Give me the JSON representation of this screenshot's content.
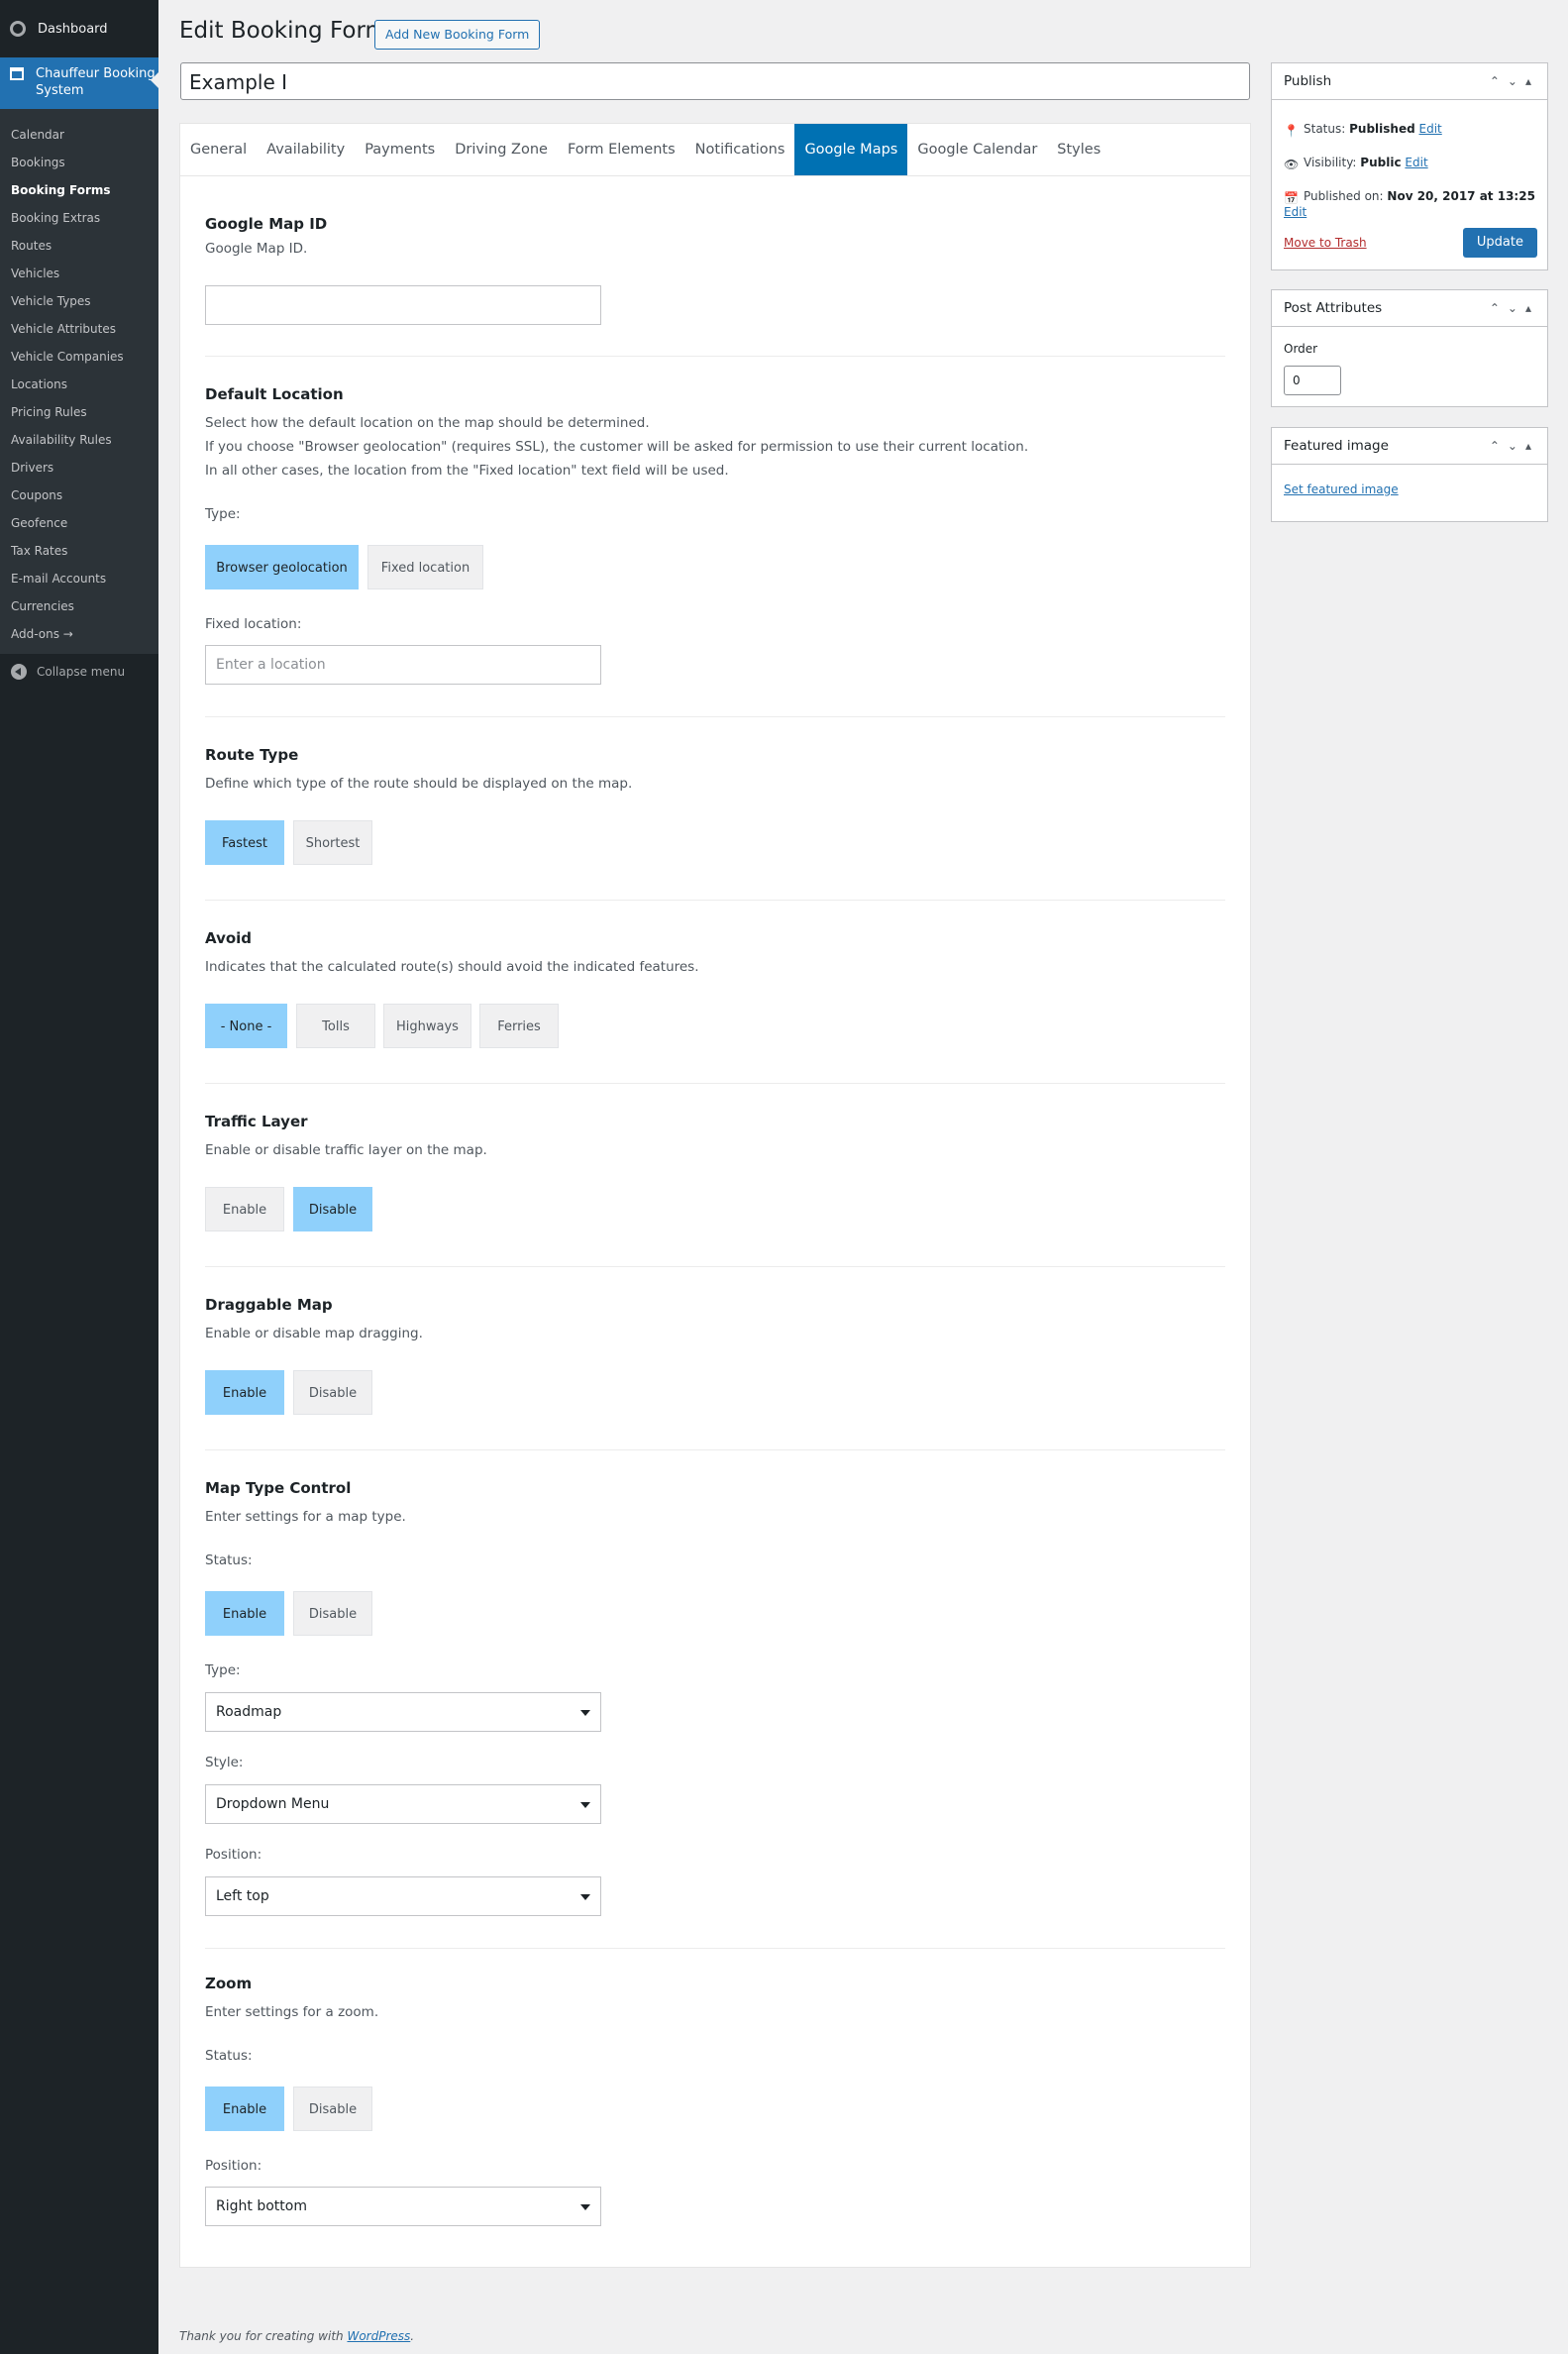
{
  "sidebar": {
    "dashboard": "Dashboard",
    "active": "Chauffeur Booking System",
    "items": [
      "Calendar",
      "Bookings",
      "Booking Forms",
      "Booking Extras",
      "Routes",
      "Vehicles",
      "Vehicle Types",
      "Vehicle Attributes",
      "Vehicle Companies",
      "Locations",
      "Pricing Rules",
      "Availability Rules",
      "Drivers",
      "Coupons",
      "Geofence",
      "Tax Rates",
      "E-mail Accounts",
      "Currencies",
      "Add-ons →"
    ],
    "current": "Booking Forms",
    "collapse": "Collapse menu"
  },
  "header": {
    "title": "Edit Booking Form",
    "add_new": "Add New Booking Form",
    "post_title": "Example I"
  },
  "tabs": [
    "General",
    "Availability",
    "Payments",
    "Driving Zone",
    "Form Elements",
    "Notifications",
    "Google Maps",
    "Google Calendar",
    "Styles"
  ],
  "active_tab": "Google Maps",
  "sections": {
    "map_id": {
      "title": "Google Map ID",
      "desc": "Google Map ID.",
      "value": ""
    },
    "default_location": {
      "title": "Default Location",
      "desc1": "Select how the default location on the map should be determined.",
      "desc2": "If you choose \"Browser geolocation\" (requires SSL), the customer will be asked for permission to use their current location.",
      "desc3": "In all other cases, the location from the \"Fixed location\" text field will be used.",
      "type_label": "Type:",
      "opt1": "Browser geolocation",
      "opt2": "Fixed location",
      "fixed_label": "Fixed location:",
      "fixed_placeholder": "Enter a location"
    },
    "route_type": {
      "title": "Route Type",
      "desc": "Define which type of the route should be displayed on the map.",
      "opt1": "Fastest",
      "opt2": "Shortest"
    },
    "avoid": {
      "title": "Avoid",
      "desc": "Indicates that the calculated route(s) should avoid the indicated features.",
      "opt1": "- None -",
      "opt2": "Tolls",
      "opt3": "Highways",
      "opt4": "Ferries"
    },
    "traffic": {
      "title": "Traffic Layer",
      "desc": "Enable or disable traffic layer on the map.",
      "opt1": "Enable",
      "opt2": "Disable"
    },
    "draggable": {
      "title": "Draggable Map",
      "desc": "Enable or disable map dragging.",
      "opt1": "Enable",
      "opt2": "Disable"
    },
    "map_type": {
      "title": "Map Type Control",
      "desc": "Enter settings for a map type.",
      "status_label": "Status:",
      "opt1": "Enable",
      "opt2": "Disable",
      "type_label": "Type:",
      "type_value": "Roadmap",
      "style_label": "Style:",
      "style_value": "Dropdown Menu",
      "position_label": "Position:",
      "position_value": "Left top"
    },
    "zoom": {
      "title": "Zoom",
      "desc": "Enter settings for a zoom.",
      "status_label": "Status:",
      "opt1": "Enable",
      "opt2": "Disable",
      "position_label": "Position:",
      "position_value": "Right bottom"
    }
  },
  "publish": {
    "title": "Publish",
    "status_label": "Status:",
    "status_value": "Published",
    "visibility_label": "Visibility:",
    "visibility_value": "Public",
    "published_label": "Published on:",
    "published_value": "Nov 20, 2017 at 13:25",
    "edit": "Edit",
    "trash": "Move to Trash",
    "update": "Update"
  },
  "attributes": {
    "title": "Post Attributes",
    "order_label": "Order",
    "order_value": "0"
  },
  "featured": {
    "title": "Featured image",
    "link": "Set featured image"
  },
  "footer": {
    "text": "Thank you for creating with",
    "link": "WordPress",
    "end": "."
  },
  "colors": {
    "accent": "#2271b1",
    "tab_active": "#0071b3",
    "selected": "#8fd0fb",
    "sidebar": "#1d2327"
  }
}
